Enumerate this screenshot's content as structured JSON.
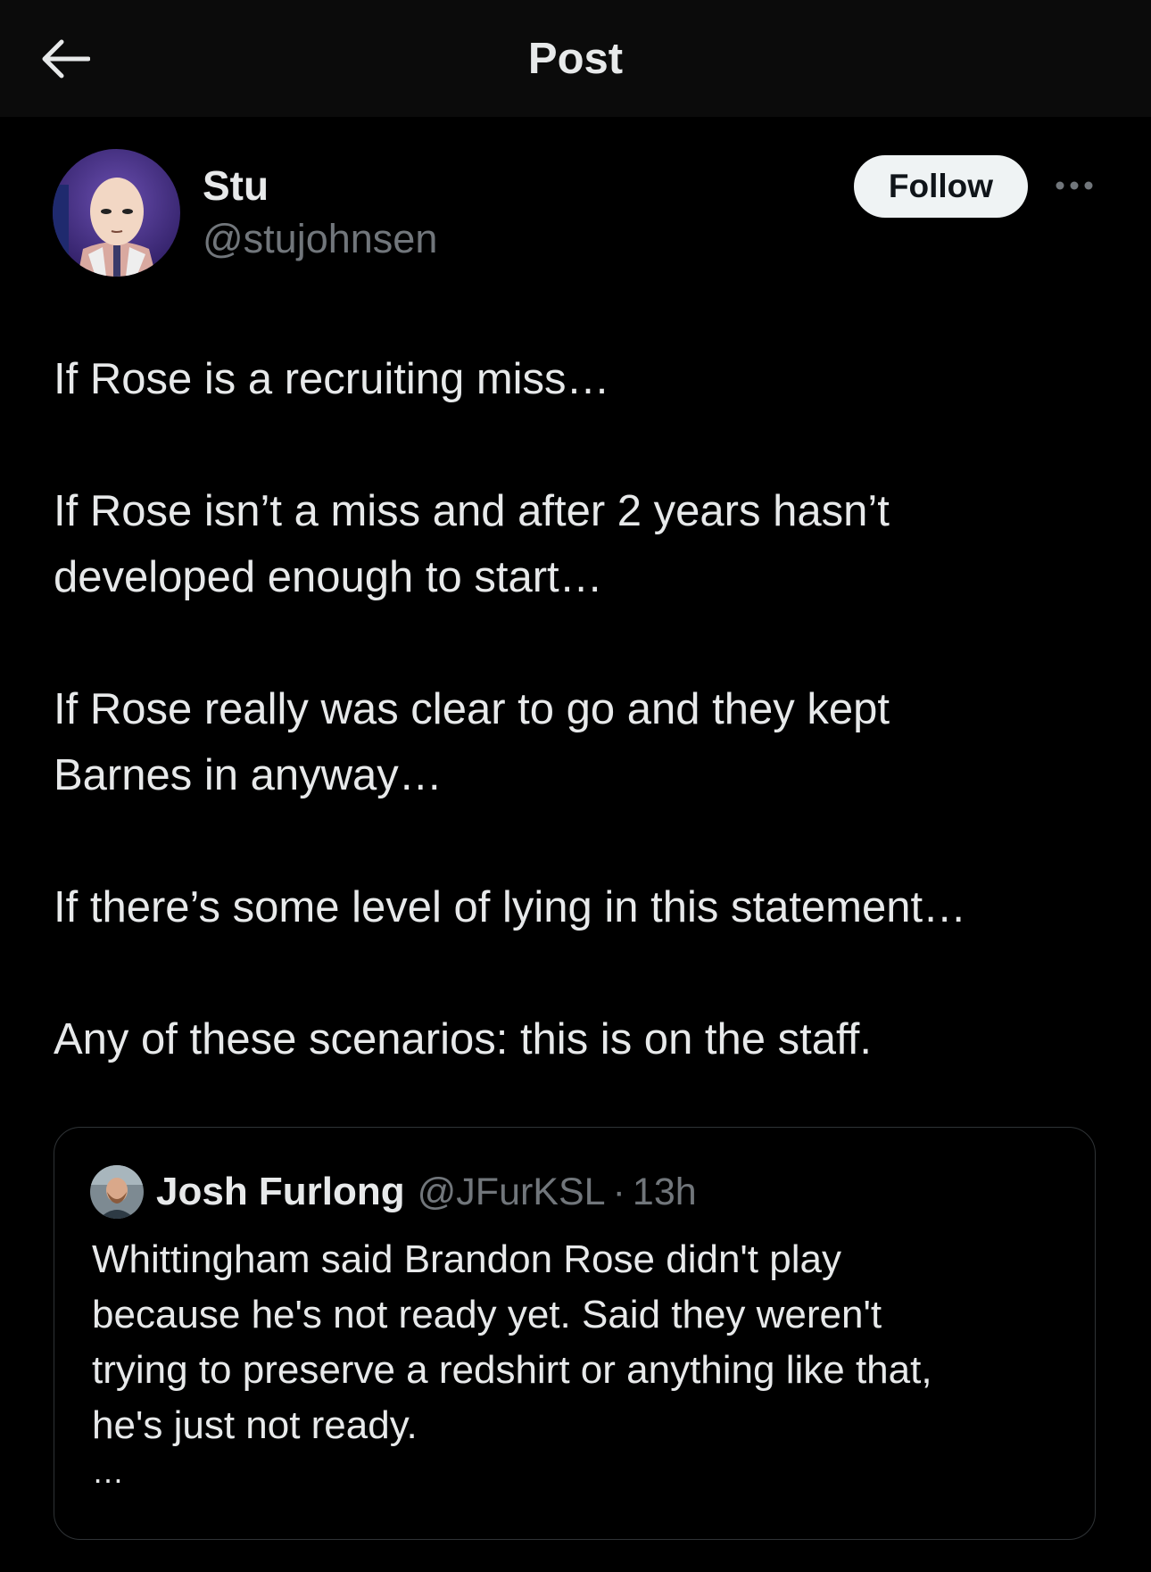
{
  "header": {
    "title": "Post",
    "back_icon": "arrow-left-icon"
  },
  "author": {
    "name": "Stu",
    "handle": "@stujohnsen",
    "avatar": "bald-hero-cartoon-avatar"
  },
  "actions": {
    "follow_label": "Follow",
    "more_icon": "more-horizontal-icon"
  },
  "post": {
    "paragraphs": [
      "If Rose is a recruiting miss…",
      "If Rose isn’t a miss and after 2 years hasn’t\ndeveloped enough to start…",
      "If Rose really was clear to go and they kept\nBarnes in anyway…",
      "If there’s some level of lying in this statement…",
      "Any of these scenarios: this is on the staff."
    ]
  },
  "quote": {
    "name": "Josh Furlong",
    "handle": "@JFurKSL",
    "separator": "·",
    "time": "13h",
    "text": "Whittingham said Brandon Rose didn't play\nbecause he's not ready yet. Said they weren't\ntrying to preserve a redshirt or anything like that,\nhe's just not ready.",
    "more": "…"
  },
  "colors": {
    "background": "#000000",
    "topbar": "#0b0b0b",
    "text": "#e7e9ea",
    "muted": "#71767b",
    "border": "#2f3336",
    "follow_bg": "#eff3f4"
  }
}
